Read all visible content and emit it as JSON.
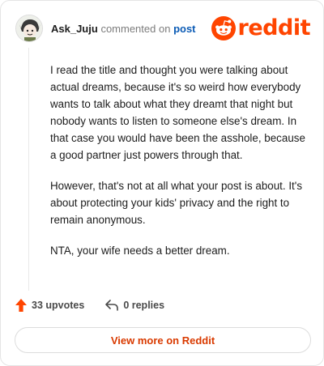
{
  "header": {
    "username": "Ask_Juju",
    "action_text": "commented on",
    "post_link": "post",
    "logo_text": "reddit",
    "brand_color": "#ff4500"
  },
  "comment": {
    "paragraphs": [
      "I read the title and thought you were talking about actual dreams, because it's so weird how everybody wants to talk about what they dreamt that night but nobody wants to listen to someone else's dream. In that case you would have been the asshole, because a good partner just powers through that.",
      "However, that's not at all what your post is about. It's about protecting your kids' privacy and the right to remain anonymous.",
      "NTA, your wife needs a better dream."
    ]
  },
  "actions": {
    "upvotes": "33 upvotes",
    "replies": "0 replies",
    "upvote_icon": "upvote-arrow-icon",
    "reply_icon": "reply-arrow-icon"
  },
  "footer": {
    "view_more": "View more on Reddit"
  }
}
